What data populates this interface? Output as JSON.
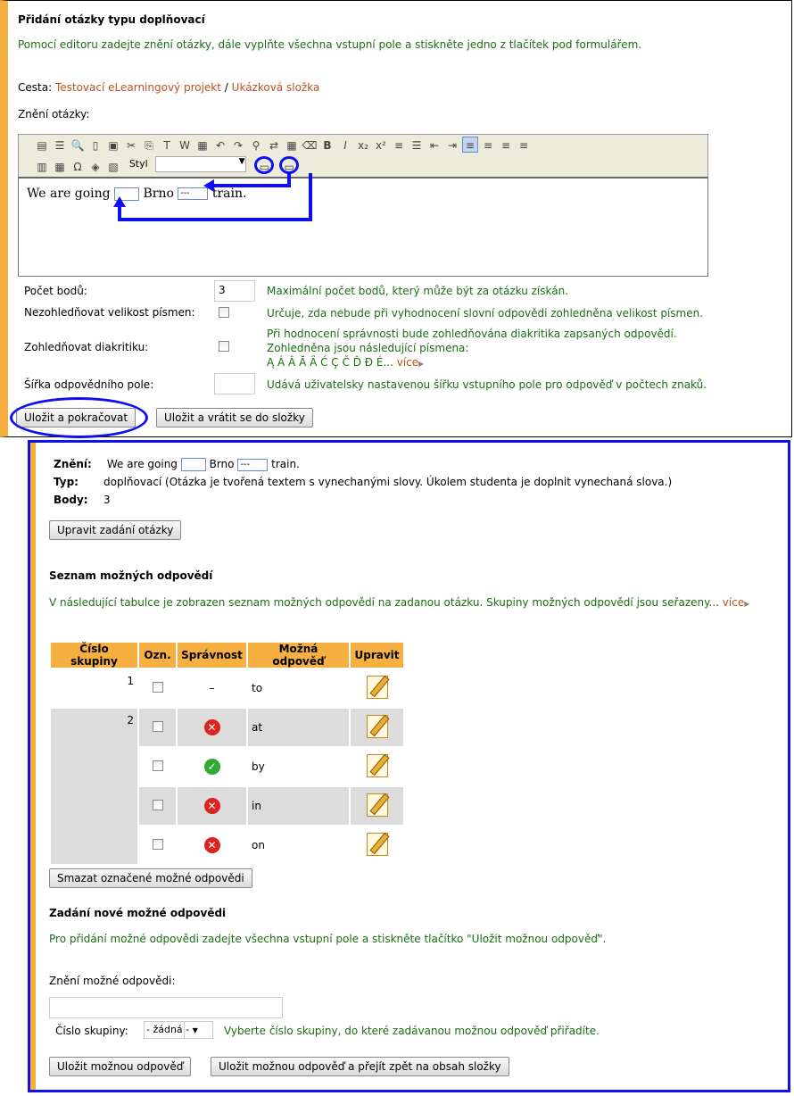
{
  "top": {
    "title": "Přidání otázky typu doplňovací",
    "intro": "Pomocí editoru zadejte znění otázky, dále vyplňte všechna vstupní pole a stiskněte jedno z tlačítek pod formulářem.",
    "path_label": "Cesta:",
    "path": [
      "Testovací eLearningový projekt",
      "Ukázková složka"
    ],
    "path_sep": "/",
    "question_label": "Znění otázky:",
    "toolbar": {
      "style_label": "Styl",
      "icons": [
        "source",
        "preview",
        "print-preview",
        "new-page",
        "templates",
        "cut",
        "copy",
        "paste-text",
        "paste-word",
        "paste",
        "undo",
        "redo",
        "find",
        "replace",
        "select-all",
        "remove-format",
        "bold",
        "italic",
        "subscript",
        "superscript",
        "numbered-list",
        "bulleted-list",
        "outdent",
        "indent",
        "align-left",
        "align-center",
        "align-right",
        "justify"
      ],
      "icons2": [
        "form",
        "table",
        "special",
        "image",
        "flash"
      ]
    },
    "editor": {
      "t1": "We are going",
      "t2": "Brno",
      "select": "---",
      "t3": "train."
    },
    "fields": [
      {
        "label": "Počet bodů:",
        "value": "3",
        "help": "Maximální počet bodů, který může být za otázku získán."
      },
      {
        "label": "Nezohledňovat velikost písmen:",
        "help": "Určuje, zda nebude při vyhodnocení slovní odpovědi zohledněna velikost písmen."
      },
      {
        "label": "Zohledňovat diakritiku:",
        "help1": "Při hodnocení správnosti bude zohledňována diakritika zapsaných odpovědí.",
        "help2": "Zohledněna jsou následující písmena:",
        "letters": "Ą Á Â Ă Ä Ć Ç Č Ď Đ É...",
        "more": "více"
      },
      {
        "label": "Šířka odpovědního pole:",
        "value": "",
        "help": "Udává uživatelsky nastavenou šířku vstupního pole pro odpověď v počtech znaků."
      }
    ],
    "btn_save_continue": "Uložit a pokračovat",
    "btn_save_return": "Uložit a vrátit se do složky"
  },
  "bottom": {
    "zneni_label": "Znění:",
    "zneni": {
      "t1": "We are going",
      "t2": "Brno",
      "select": "---",
      "t3": "train."
    },
    "typ_label": "Typ:",
    "typ": "doplňovací (Otázka je tvořená textem s vynechanými slovy. Úkolem studenta je doplnit vynechaná slova.)",
    "body_label": "Body:",
    "body": "3",
    "btn_edit": "Upravit zadání otázky",
    "list_title": "Seznam možných odpovědí",
    "list_intro": "V následující tabulce je zobrazen seznam možných odpovědí na zadanou otázku. Skupiny možných odpovědí jsou seřazeny...",
    "more": "více",
    "table": {
      "headers": [
        "Číslo skupiny",
        "Ozn.",
        "Správnost",
        "Možná odpověď",
        "Upravit"
      ],
      "rows": [
        {
          "group": "1",
          "correct": "–",
          "answer": "to"
        },
        {
          "group": "2",
          "correct": "wrong",
          "answer": "at"
        },
        {
          "group": "",
          "correct": "right",
          "answer": "by"
        },
        {
          "group": "",
          "correct": "wrong",
          "answer": "in"
        },
        {
          "group": "",
          "correct": "wrong",
          "answer": "on"
        }
      ]
    },
    "btn_delete": "Smazat označené možné odpovědi",
    "new_title": "Zadání nové možné odpovědi",
    "new_intro": "Pro přidání možné odpovědi zadejte všechna vstupní pole a stiskněte tlačítko \"Uložit možnou odpověď\".",
    "answer_label": "Znění možné odpovědi:",
    "answer_value": "",
    "group_label": "Číslo skupiny:",
    "group_value": "- žádná -",
    "group_help": "Vyberte číslo skupiny, do které zadávanou možnou odpověď přiřadíte.",
    "btn_save": "Uložit možnou odpověď",
    "btn_save_back": "Uložit možnou odpověď a přejít zpět na obsah složky"
  },
  "colors": {
    "accent": "#f5b041",
    "annotation": "#1010ee",
    "help_text": "#1a6e12",
    "link": "#c0501e"
  }
}
